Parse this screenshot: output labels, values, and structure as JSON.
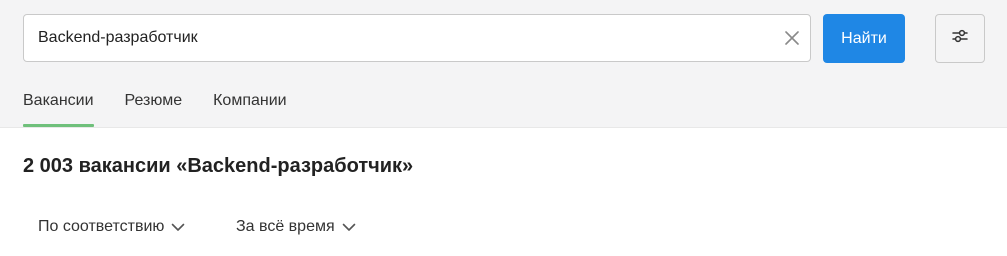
{
  "search": {
    "value": "Backend-разработчик",
    "clear_icon": "close-icon"
  },
  "buttons": {
    "find_label": "Найти",
    "filter_icon": "sliders-icon"
  },
  "tabs": [
    {
      "label": "Вакансии",
      "active": true
    },
    {
      "label": "Резюме",
      "active": false
    },
    {
      "label": "Компании",
      "active": false
    }
  ],
  "results": {
    "title": "2 003 вакансии «Backend-разработчик»"
  },
  "sorting": {
    "order_label": "По соответствию",
    "period_label": "За всё время"
  },
  "colors": {
    "accent_button": "#1f87e5",
    "active_tab_underline": "#6fc07b",
    "header_background": "#f4f4f5"
  }
}
